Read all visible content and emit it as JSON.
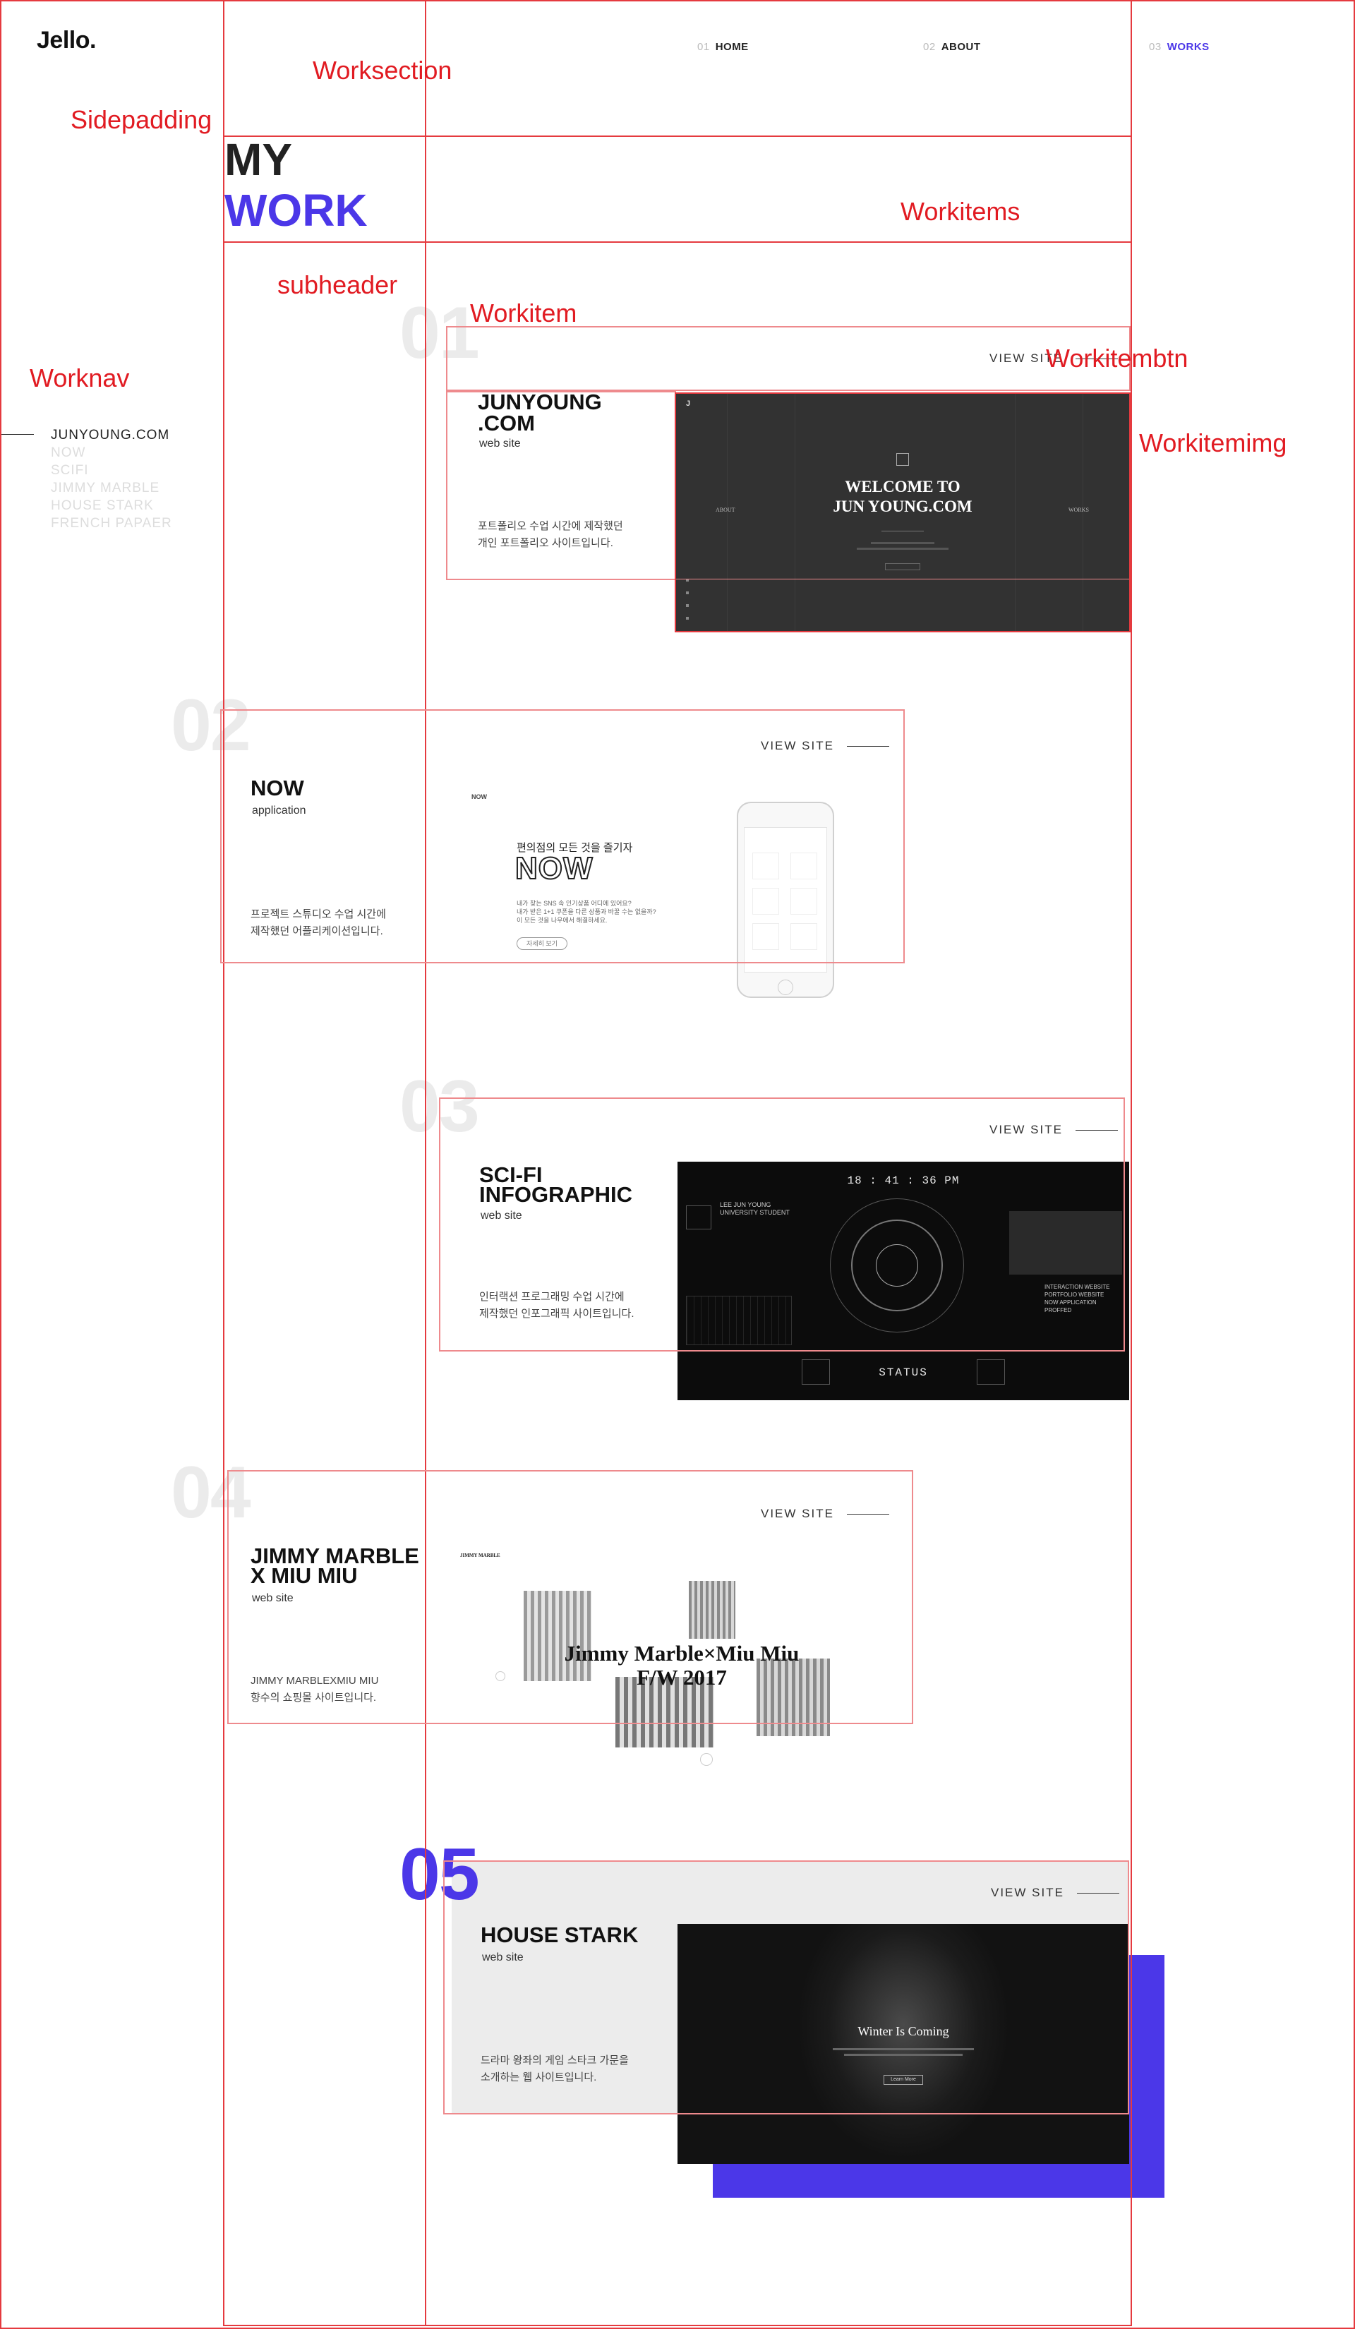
{
  "site": {
    "logo": "Jello."
  },
  "nav": [
    {
      "num": "01",
      "label": "HOME"
    },
    {
      "num": "02",
      "label": "ABOUT"
    },
    {
      "num": "03",
      "label": "WORKS"
    }
  ],
  "title": {
    "line1": "MY",
    "line2": "WORK"
  },
  "worknav": [
    "JUNYOUNG.COM",
    "NOW",
    "SCIFI",
    "JIMMY MARBLE",
    "HOUSE STARK",
    "FRENCH PAPAER"
  ],
  "annotations": {
    "worksection": "Worksection",
    "sidepadding": "Sidepadding",
    "workitems": "Workitems",
    "subheader": "subheader",
    "workitem": "Workitem",
    "workitembtn": "Workitembtn",
    "worknav": "Worknav",
    "workitemimg": "Workitemimg"
  },
  "view_site": "VIEW SITE",
  "works": [
    {
      "num": "01",
      "name_l1": "JUNYOUNG",
      "name_l2": ".COM",
      "type": "web site",
      "desc_l1": "포트폴리오 수업 시간에 제작했던",
      "desc_l2": "개인 포트폴리오 사이트입니다."
    },
    {
      "num": "02",
      "name_l1": "NOW",
      "name_l2": "",
      "type": "application",
      "desc_l1": "프로젝트 스튜디오 수업 시간에",
      "desc_l2": "제작했던 어플리케이션입니다."
    },
    {
      "num": "03",
      "name_l1": "SCI-FI",
      "name_l2": "INFOGRAPHIC",
      "type": "web site",
      "desc_l1": "인터랙션 프로그래밍 수업 시간에",
      "desc_l2": "제작했던 인포그래픽 사이트입니다."
    },
    {
      "num": "04",
      "name_l1": "JIMMY MARBLE",
      "name_l2": "X MIU MIU",
      "type": "web site",
      "desc_l1": "JIMMY MARBLEXMIU MIU",
      "desc_l2": "향수의 쇼핑몰 사이트입니다."
    },
    {
      "num": "05",
      "name_l1": "HOUSE STARK",
      "name_l2": "",
      "type": "web site",
      "desc_l1": "드라마 왕좌의 게임 스타크 가문을",
      "desc_l2": "소개하는 웹 사이트입니다."
    }
  ],
  "mock1": {
    "corner": "J",
    "heading_l1": "WELCOME TO",
    "heading_l2": "JUN YOUNG.COM",
    "left": "ABOUT",
    "right": "WORKS"
  },
  "mock2": {
    "label": "NOW",
    "headline": "편의점의 모든 것을 즐기자",
    "logo": "NOW",
    "body_l1": "내가 찾는 SNS 속 인기상품 어디에 있어요?",
    "body_l2": "내가 받은 1+1 쿠폰을 다른 상품과 바꿀 수는 없을까?",
    "body_l3": "이 모든 것을 나우에서 해결하세요.",
    "btn": "자세히 보기"
  },
  "mock3": {
    "time": "18 : 41 : 36  PM",
    "name_l1": "LEE JUN YOUNG",
    "name_l2": "UNIVERSITY STUDENT",
    "status": "STATUS",
    "item1": "INTERACTION WEBSITE",
    "item2": "PORTFOLIO WEBSITE",
    "item3": "NOW APPLICATION PROFFED"
  },
  "mock4": {
    "brand": "JIMMY MARBLE",
    "title_l1": "Jimmy Marble×Miu Miu",
    "title_l2": "F/W 2017"
  },
  "mock5": {
    "title": "Winter Is Coming",
    "btn": "Learn More"
  },
  "colors": {
    "accent": "#4b37e8",
    "annotation": "#e11b22"
  }
}
